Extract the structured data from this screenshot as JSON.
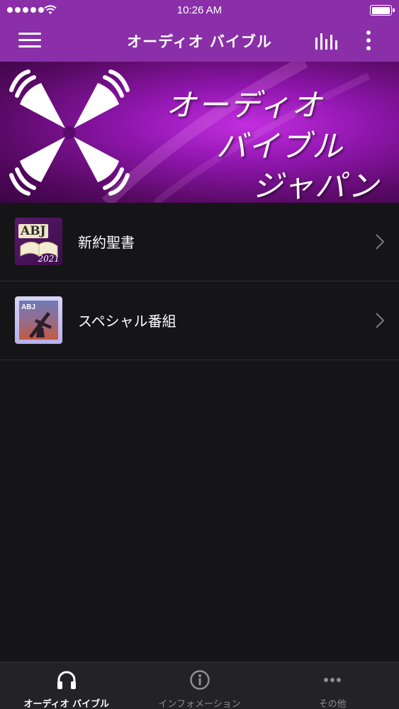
{
  "status_bar": {
    "time": "10:26 AM"
  },
  "nav": {
    "title": "オーディオ バイブル"
  },
  "banner": {
    "line1": "オーディオ",
    "line2": "バイブル",
    "line3": "ジャパン"
  },
  "list": {
    "items": [
      {
        "label": "新約聖書",
        "thumb_text": "ABJ",
        "thumb_year": "2021",
        "icon": "chevron-right-icon"
      },
      {
        "label": "スペシャル番組",
        "thumb_text": "ABJ",
        "icon": "chevron-right-icon"
      }
    ]
  },
  "tabbar": {
    "tabs": [
      {
        "label": "オーディオ バイブル",
        "icon": "headphones-icon",
        "active": true
      },
      {
        "label": "インフォメーション",
        "icon": "info-icon",
        "active": false
      },
      {
        "label": "その他",
        "icon": "more-horizontal-icon",
        "active": false
      }
    ]
  },
  "colors": {
    "nav_bg": "#8a2fa8",
    "background": "#151517",
    "tabbar_bg": "#232326",
    "active_tab": "#ffffff",
    "inactive_tab": "#8e8e93"
  }
}
